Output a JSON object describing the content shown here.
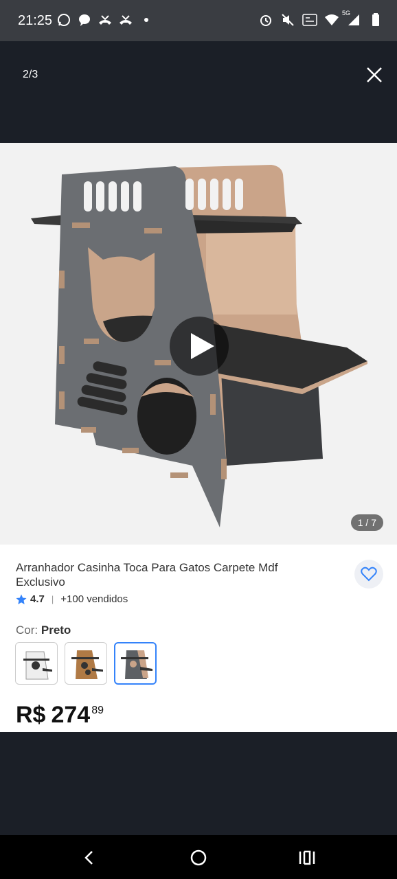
{
  "status_bar": {
    "time": "21:25",
    "left_icons": [
      "whatsapp-icon",
      "chat-icon",
      "missed-call-icon",
      "missed-call-icon",
      "dot-icon"
    ],
    "right_icons": [
      "alarm-icon",
      "mute-icon",
      "volte-icon",
      "wifi-icon",
      "signal-icon",
      "battery-icon"
    ],
    "network_label": "5G"
  },
  "viewer": {
    "counter": "2/3",
    "close_icon": "close-icon"
  },
  "product": {
    "image_counter": "1 / 7",
    "title": "Arranhador Casinha Toca Para Gatos Carpete Mdf Exclusivo",
    "rating": "4.7",
    "sold": "+100 vendidos",
    "variant_label": "Cor:",
    "variant_value": "Preto",
    "variants": [
      "variant-white",
      "variant-wood",
      "variant-black"
    ],
    "selected_variant": 2,
    "price_currency": "R$",
    "price_integer": "274",
    "price_cents": "89"
  },
  "colors": {
    "accent": "#3483fa",
    "star": "#3483fa",
    "dark_bg": "#1b1f27"
  },
  "navigation": [
    "back-icon",
    "home-icon",
    "recents-icon"
  ]
}
